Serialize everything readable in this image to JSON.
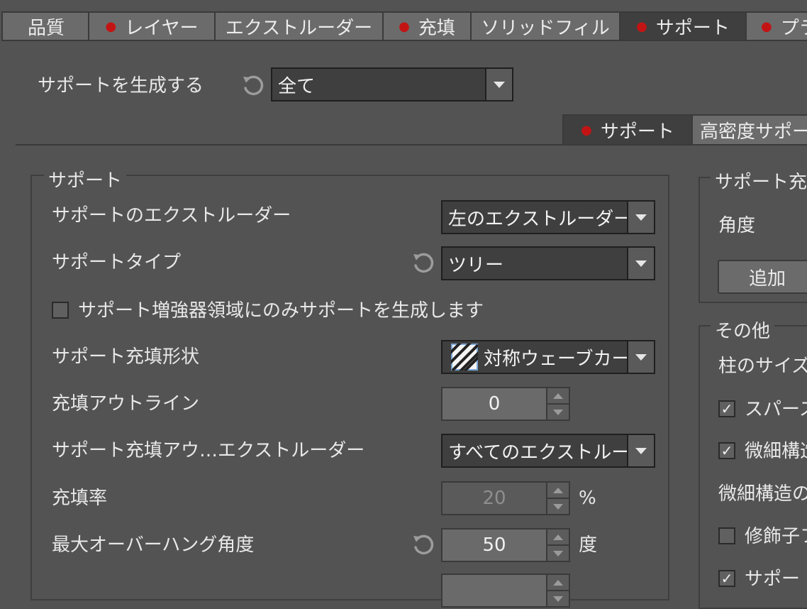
{
  "top_tabs": [
    {
      "label": "品質",
      "dot": false,
      "active": false
    },
    {
      "label": "レイヤー",
      "dot": true,
      "active": false
    },
    {
      "label": "エクストルーダー",
      "dot": false,
      "active": false
    },
    {
      "label": "充填",
      "dot": true,
      "active": false
    },
    {
      "label": "ソリッドフィル",
      "dot": false,
      "active": false
    },
    {
      "label": "サポート",
      "dot": true,
      "active": true
    },
    {
      "label": "プラ",
      "dot": true,
      "active": false
    }
  ],
  "generate": {
    "label": "サポートを生成する",
    "value": "全て"
  },
  "sub_tabs": [
    {
      "label": "サポート",
      "dot": true,
      "active": true
    },
    {
      "label": "高密度サポー",
      "dot": false,
      "active": false
    }
  ],
  "support_group": {
    "title": "サポート",
    "extruder": {
      "label": "サポートのエクストルーダー",
      "value": "左のエクストルーダー"
    },
    "type": {
      "label": "サポートタイプ",
      "value": "ツリー"
    },
    "enforcer_only": {
      "label": "サポート増強器領域にのみサポートを生成します",
      "checked": false
    },
    "infill_shape": {
      "label": "サポート充填形状",
      "value": "対称ウェーブカー"
    },
    "infill_outline": {
      "label": "充填アウトライン",
      "value": "0"
    },
    "outline_extruder": {
      "label": "サポート充填アウ…エクストルーダー",
      "value": "すべてのエクストルー"
    },
    "infill_rate": {
      "label": "充填率",
      "value": "20",
      "unit": "%"
    },
    "overhang": {
      "label": "最大オーバーハング角度",
      "value": "50",
      "unit": "度"
    }
  },
  "right_group1": {
    "title": "サポート充",
    "angle_label": "角度",
    "add_button": "追加"
  },
  "right_group2": {
    "title": "その他",
    "pillar_label": "柱のサイズ",
    "sparse_label": "スパース",
    "sparse_checked": true,
    "fine1_label": "微細構造",
    "fine1_checked": true,
    "fine2_label": "微細構造の",
    "decor_label": "修飾子フ",
    "decor_checked": false,
    "support_label": "サポー",
    "support_checked": true
  },
  "colors": {
    "background": "#535353",
    "dot": "#c31414",
    "combo": "#3f3f3f"
  }
}
